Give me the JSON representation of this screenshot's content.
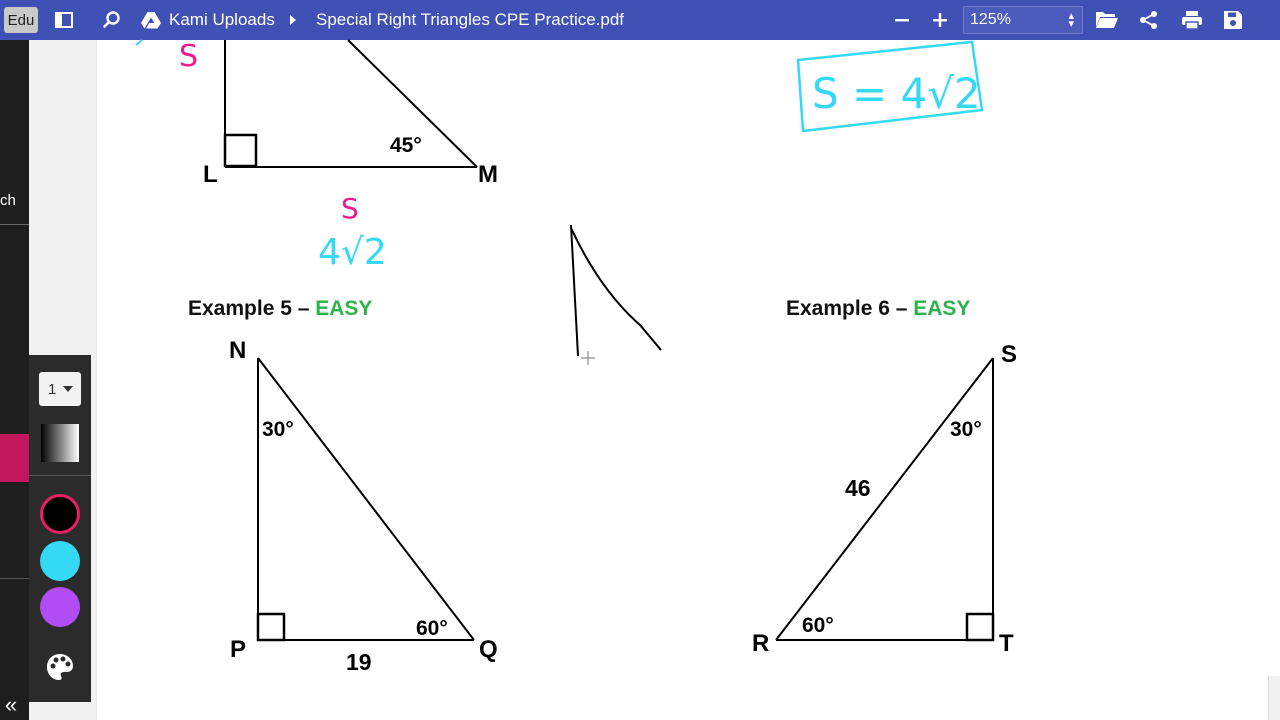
{
  "toolbar": {
    "badge": "Edu",
    "breadcrumb_folder": "Kami Uploads",
    "file_name": "Special Right Triangles CPE Practice.pdf",
    "zoom_level": "125%",
    "accent_color": "#3f51b5"
  },
  "left_strip": {
    "partial_text": "ch"
  },
  "tool_panel": {
    "stroke_size": "1",
    "colors": [
      "#000000",
      "#33d9f5",
      "#b24cf5"
    ],
    "selected_color": "#000000",
    "selected_ring_color": "#e91e63"
  },
  "document": {
    "prev_triangle": {
      "vertex_l": "L",
      "vertex_m": "M",
      "angle": "45°",
      "annotation_side": "S",
      "annotation_value": "4√2",
      "answer_box": "S = 4√2"
    },
    "example5": {
      "heading_prefix": "Example 5 –",
      "heading_level": "EASY",
      "vertex_n": "N",
      "vertex_p": "P",
      "vertex_q": "Q",
      "angle_top": "30°",
      "angle_bottom": "60°",
      "side_length": "19"
    },
    "example6": {
      "heading_prefix": "Example 6 –",
      "heading_level": "EASY",
      "vertex_s": "S",
      "vertex_r": "R",
      "vertex_t": "T",
      "angle_top": "30°",
      "angle_bottom": "60°",
      "hypotenuse": "46"
    },
    "ink_colors": {
      "pink": "#e91e8c",
      "cyan": "#33d9f5",
      "black": "#000000"
    }
  }
}
